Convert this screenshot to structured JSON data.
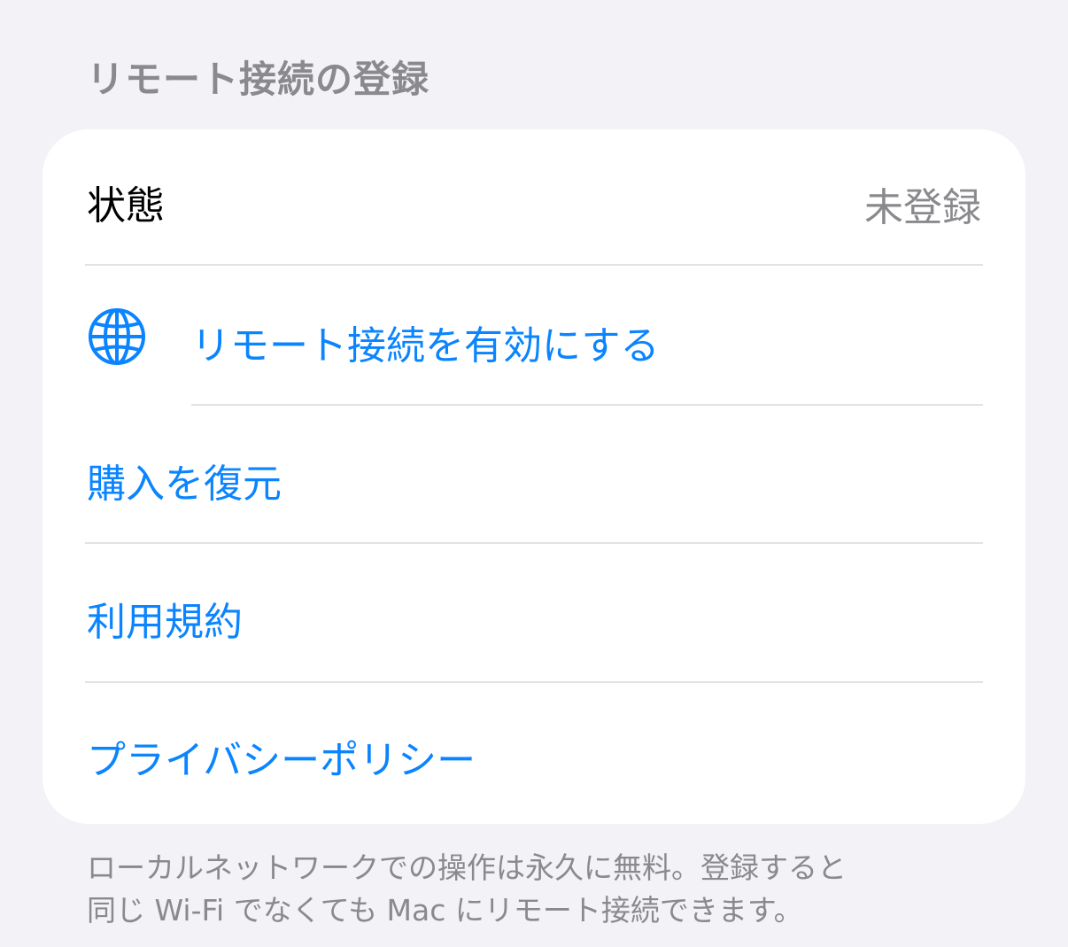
{
  "section": {
    "title": "リモート接続の登録"
  },
  "rows": {
    "status": {
      "label": "状態",
      "value": "未登録"
    },
    "remote": {
      "label": "リモート接続を有効にする",
      "icon": "globe-icon"
    },
    "restore": {
      "label": "購入を復元"
    },
    "terms": {
      "label": "利用規約"
    },
    "privacy": {
      "label": "プライバシーポリシー"
    }
  },
  "footer": {
    "line1": "ローカルネットワークでの操作は永久に無料。登録すると",
    "line2": "同じ Wi-Fi でなくても Mac にリモート接続できます。"
  },
  "colors": {
    "background": "#f2f2f7",
    "card": "#ffffff",
    "accent": "#0a84ff",
    "secondary_text": "#8a8a8e",
    "divider": "#e2e2e6"
  }
}
